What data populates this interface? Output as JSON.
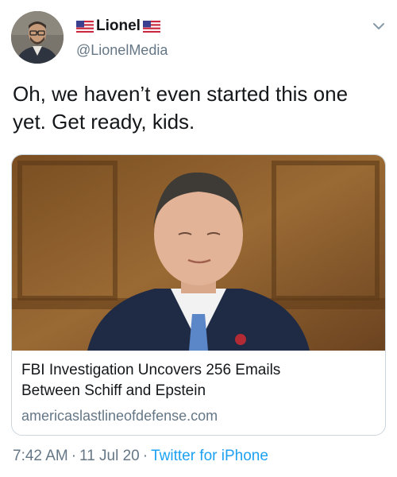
{
  "user": {
    "display_name": "Lionel",
    "handle": "@LionelMedia",
    "avatar_icon": "avatar-photo",
    "name_decoration_icon": "us-flag-icon"
  },
  "tweet": {
    "text": "Oh, we haven’t even started this one yet. Get ready, kids."
  },
  "card": {
    "title_line_1": "FBI Investigation Uncovers 256 Emails",
    "title_line_2": "Between Schiff and Epstein",
    "domain": "americaslastlineofdefense.com"
  },
  "meta": {
    "time": "7:42 AM",
    "date": "11 Jul 20",
    "source": "Twitter for iPhone",
    "separator": "·"
  },
  "colors": {
    "text": "#14171a",
    "secondary": "#657786",
    "link": "#1da1f2",
    "border": "#ccd6dd"
  }
}
